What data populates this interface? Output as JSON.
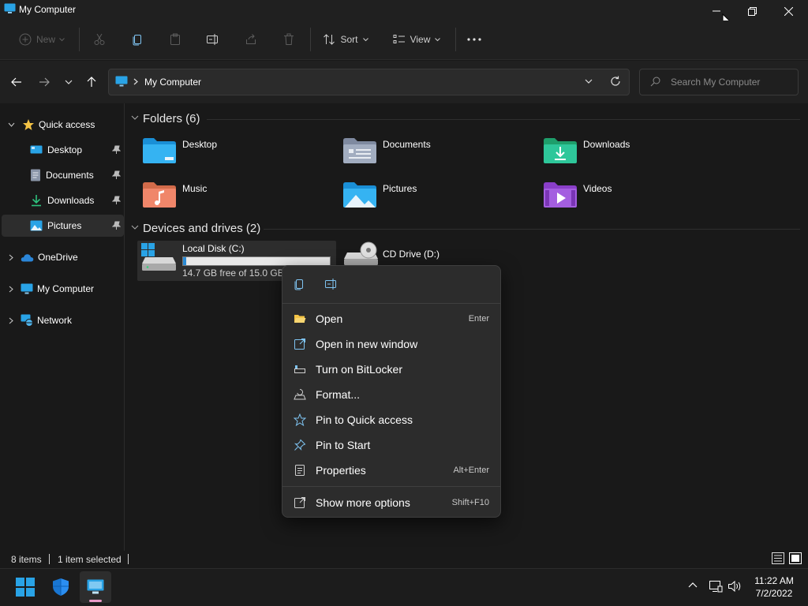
{
  "window": {
    "title": "My Computer"
  },
  "commandbar": {
    "new_label": "New",
    "sort_label": "Sort",
    "view_label": "View"
  },
  "address": {
    "path": "My Computer",
    "search_placeholder": "Search My Computer"
  },
  "sidebar": {
    "quick_access": "Quick access",
    "items": [
      {
        "label": "Desktop",
        "pinned": true
      },
      {
        "label": "Documents",
        "pinned": true
      },
      {
        "label": "Downloads",
        "pinned": true
      },
      {
        "label": "Pictures",
        "pinned": true,
        "selected": true
      }
    ],
    "onedrive": "OneDrive",
    "my_computer": "My Computer",
    "network": "Network"
  },
  "main": {
    "folders_title": "Folders (6)",
    "folders": [
      "Desktop",
      "Documents",
      "Downloads",
      "Music",
      "Pictures",
      "Videos"
    ],
    "drives_title": "Devices and drives (2)",
    "drives": [
      {
        "name": "Local Disk (C:)",
        "free": "14.7 GB free of 15.0 GB",
        "used_fraction": 0.02
      },
      {
        "name": "CD Drive (D:)"
      }
    ]
  },
  "context_menu": {
    "items": [
      {
        "label": "Open",
        "shortcut": "Enter"
      },
      {
        "label": "Open in new window",
        "shortcut": ""
      },
      {
        "label": "Turn on BitLocker",
        "shortcut": ""
      },
      {
        "label": "Format...",
        "shortcut": ""
      },
      {
        "label": "Pin to Quick access",
        "shortcut": ""
      },
      {
        "label": "Pin to Start",
        "shortcut": ""
      },
      {
        "label": "Properties",
        "shortcut": "Alt+Enter"
      },
      {
        "label": "Show more options",
        "shortcut": "Shift+F10"
      }
    ]
  },
  "statusbar": {
    "items_count": "8 items",
    "selection": "1 item selected"
  },
  "taskbar": {
    "time": "11:22 AM",
    "date": "7/2/2022"
  },
  "colors": {
    "accent": "#2a8ad4",
    "folder_yellow": "#f3c345",
    "background": "#191919"
  }
}
